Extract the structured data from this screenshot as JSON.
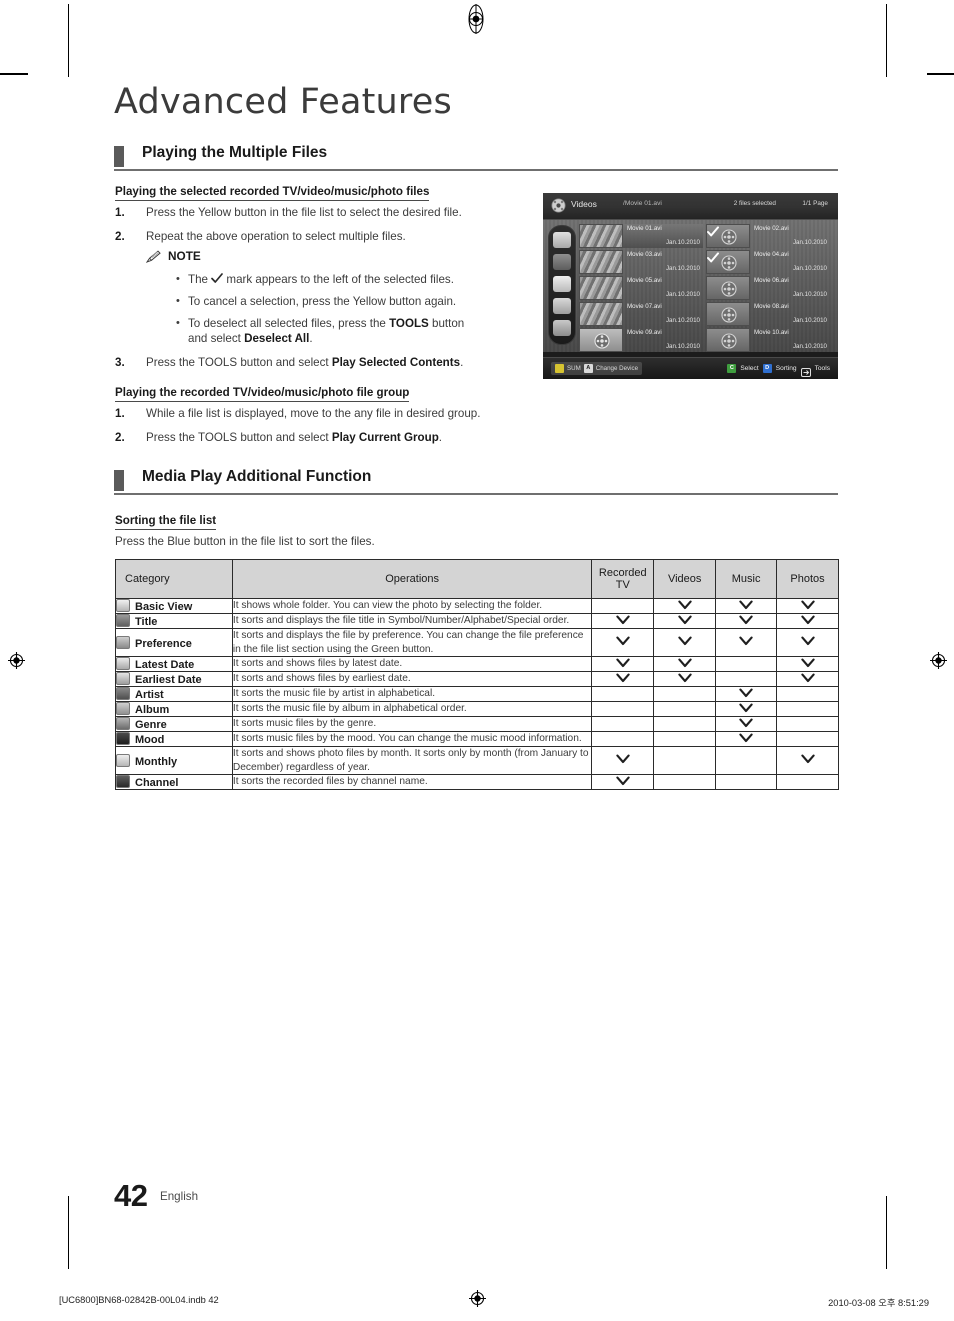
{
  "document": {
    "chapter_title": "Advanced Features",
    "page_number": "42",
    "page_language": "English"
  },
  "section1": {
    "title": "Playing the Multiple Files",
    "sub1": {
      "heading": "Playing the selected recorded TV/video/music/photo files",
      "steps": [
        {
          "num": "1.",
          "text": "Press the Yellow button in the file list to select the desired file."
        },
        {
          "num": "2.",
          "text": "Repeat the above operation to select multiple files."
        }
      ],
      "note_label": "NOTE",
      "bullets": [
        {
          "pre": "The ",
          "has_check": true,
          "post": " mark appears to the left of the selected files."
        },
        {
          "pre": "To cancel a selection, press the Yellow button again.",
          "has_check": false,
          "post": ""
        }
      ],
      "bullet3_line1_a": "To deselect all selected files, press the ",
      "bullet3_line1_b": "TOOLS",
      "bullet3_line1_c": " button",
      "bullet3_line2_a": "and select ",
      "bullet3_line2_b": "Deselect All",
      "bullet3_line2_c": ".",
      "step3": {
        "num": "3.",
        "a": "Press the ",
        "b": "TOOLS",
        "c": " button and select ",
        "d": "Play Selected Contents",
        "e": "."
      }
    },
    "sub2": {
      "heading": "Playing the recorded TV/video/music/photo file group",
      "step1": {
        "num": "1.",
        "text": "While a file list is displayed, move to the any file in desired group."
      },
      "step2": {
        "num": "2.",
        "a": "Press the ",
        "b": "TOOLS",
        "c": " button and select ",
        "d": "Play Current Group",
        "e": "."
      }
    }
  },
  "section2": {
    "title": "Media Play Additional Function",
    "sub_heading": "Sorting the file list",
    "sub_text": "Press the Blue button in the file list to sort the files."
  },
  "tv_screenshot": {
    "mode_label": "Videos",
    "current_file": "/Movie 01.avi",
    "selected_count": "2 files selected",
    "page_indicator": "1/1 Page",
    "rail_icons": [
      "folder-icon",
      "title-sort-icon",
      "latest-date-icon",
      "earliest-date-icon",
      "preference-star-icon"
    ],
    "files": [
      {
        "name": "Movie 01.avi",
        "date": "Jan.10.2010",
        "thumb": "image",
        "checked": false,
        "highlighted": true
      },
      {
        "name": "Movie 02.avi",
        "date": "Jan.10.2010",
        "thumb": "reel",
        "checked": true,
        "highlighted": false
      },
      {
        "name": "Movie 03.avi",
        "date": "Jan.10.2010",
        "thumb": "image",
        "checked": false,
        "highlighted": false
      },
      {
        "name": "Movie 04.avi",
        "date": "Jan.10.2010",
        "thumb": "reel",
        "checked": true,
        "highlighted": false
      },
      {
        "name": "Movie 05.avi",
        "date": "Jan.10.2010",
        "thumb": "image",
        "checked": false,
        "highlighted": false
      },
      {
        "name": "Movie 06.avi",
        "date": "Jan.10.2010",
        "thumb": "reel",
        "checked": false,
        "highlighted": false
      },
      {
        "name": "Movie 07.avi",
        "date": "Jan.10.2010",
        "thumb": "image",
        "checked": false,
        "highlighted": false
      },
      {
        "name": "Movie 08.avi",
        "date": "Jan.10.2010",
        "thumb": "reel",
        "checked": false,
        "highlighted": false
      },
      {
        "name": "Movie 09.avi",
        "date": "Jan.10.2010",
        "thumb": "reel",
        "checked": false,
        "highlighted": false
      },
      {
        "name": "Movie 10.avi",
        "date": "Jan.10.2010",
        "thumb": "reel",
        "checked": false,
        "highlighted": false
      }
    ],
    "footer": {
      "sum_label": "SUM",
      "change_device_key": "A",
      "change_device_label": "Change Device",
      "select_key": "C",
      "select_label": "Select",
      "sorting_key": "D",
      "sorting_label": "Sorting",
      "tools_label": "Tools"
    }
  },
  "sorting_table": {
    "headers": [
      "Category",
      "Operations",
      "Recorded TV",
      "Videos",
      "Music",
      "Photos"
    ],
    "header_recorded_line1": "Recorded",
    "header_recorded_line2": "TV",
    "rows": [
      {
        "icon": "folder-icon",
        "category": "Basic View",
        "operations": "It shows whole folder. You can view the photo by selecting the folder.",
        "recorded_tv": false,
        "videos": true,
        "music": true,
        "photos": true
      },
      {
        "icon": "title-sort-icon",
        "category": "Title",
        "operations": "It sorts and displays the file title in Symbol/Number/Alphabet/Special order.",
        "recorded_tv": true,
        "videos": true,
        "music": true,
        "photos": true
      },
      {
        "icon": "star-icon",
        "category": "Preference",
        "operations": "It sorts and displays the file by preference. You can change the file preference in the file list section using the Green button.",
        "recorded_tv": true,
        "videos": true,
        "music": true,
        "photos": true
      },
      {
        "icon": "calendar-30-icon",
        "category": "Latest Date",
        "operations": "It sorts and shows files by latest date.",
        "recorded_tv": true,
        "videos": true,
        "music": false,
        "photos": true
      },
      {
        "icon": "calendar-1-icon",
        "category": "Earliest Date",
        "operations": "It sorts and shows files by earliest date.",
        "recorded_tv": true,
        "videos": true,
        "music": false,
        "photos": true
      },
      {
        "icon": "artist-icon",
        "category": "Artist",
        "operations": "It sorts the music file by artist in alphabetical.",
        "recorded_tv": false,
        "videos": false,
        "music": true,
        "photos": false
      },
      {
        "icon": "album-icon",
        "category": "Album",
        "operations": "It sorts the music file by album in alphabetical order.",
        "recorded_tv": false,
        "videos": false,
        "music": true,
        "photos": false
      },
      {
        "icon": "genre-icon",
        "category": "Genre",
        "operations": "It sorts music files by the genre.",
        "recorded_tv": false,
        "videos": false,
        "music": true,
        "photos": false
      },
      {
        "icon": "mood-icon",
        "category": "Mood",
        "operations": "It sorts music files by the mood. You can change the music mood information.",
        "recorded_tv": false,
        "videos": false,
        "music": true,
        "photos": false
      },
      {
        "icon": "monthly-calendar-icon",
        "category": "Monthly",
        "operations": "It sorts and shows photo files by month. It sorts only by month (from January to December) regardless of year.",
        "recorded_tv": true,
        "videos": false,
        "music": false,
        "photos": true
      },
      {
        "icon": "channel-icon",
        "category": "Channel",
        "operations": "It sorts the recorded files by channel name.",
        "recorded_tv": true,
        "videos": false,
        "music": false,
        "photos": false
      }
    ]
  },
  "printer_footer": {
    "left": "[UC6800]BN68-02842B-00L04.indb   42",
    "right": "2010-03-08   오후 8:51:29"
  }
}
